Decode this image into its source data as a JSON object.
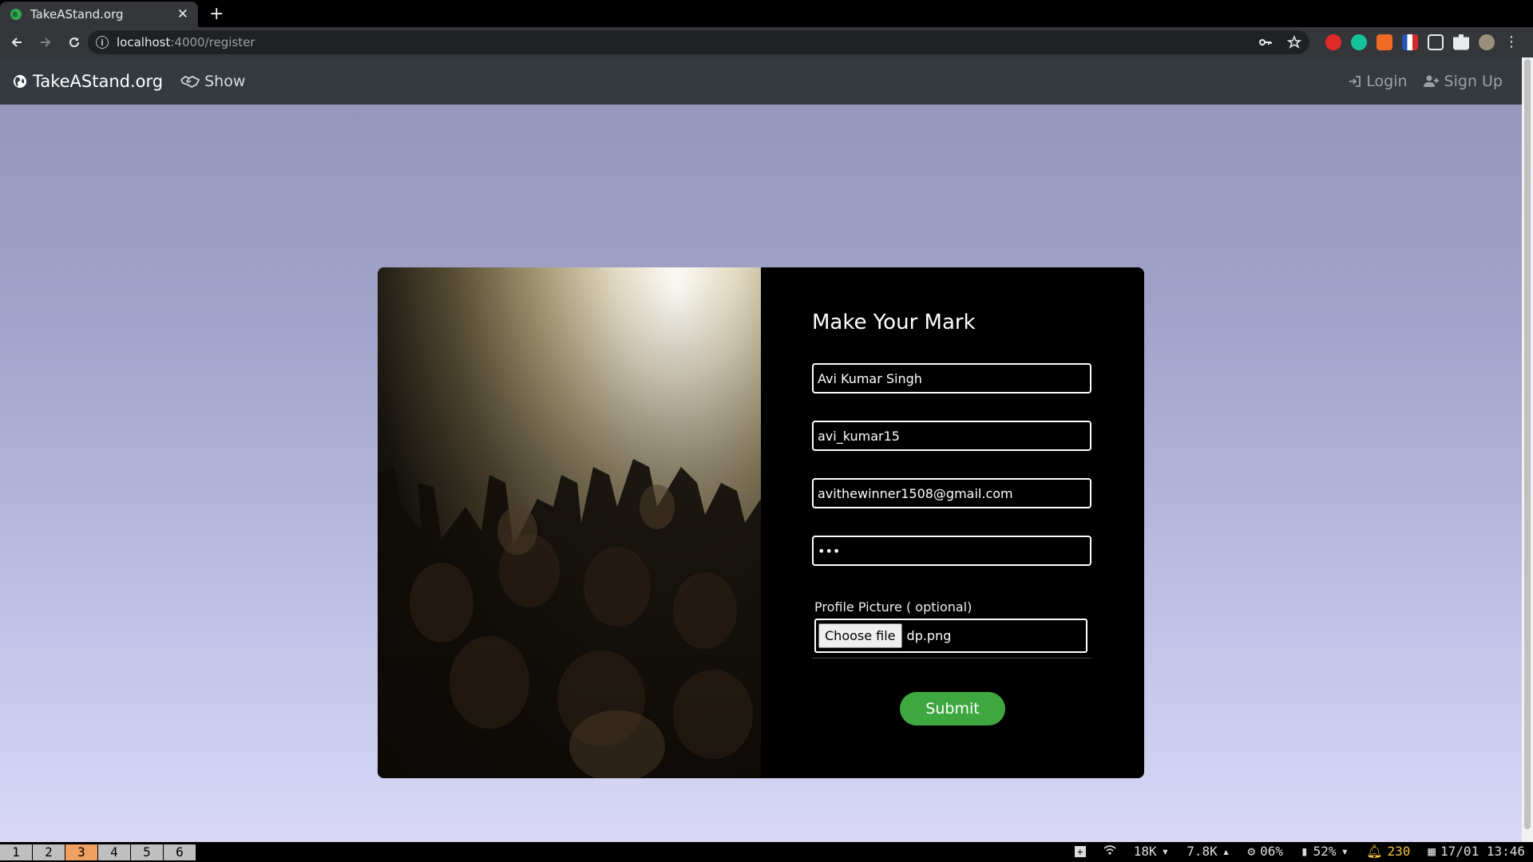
{
  "browser": {
    "tab_title": "TakeAStand.org",
    "url_host": "localhost",
    "url_path": ":4000/register"
  },
  "site": {
    "brand": "TakeAStand.org",
    "show_label": "Show",
    "login_label": "Login",
    "signup_label": "Sign Up"
  },
  "form": {
    "title": "Make Your Mark",
    "name_value": "Avi Kumar Singh",
    "username_value": "avi_kumar15",
    "email_value": "avithewinner1508@gmail.com",
    "password_value": "•••",
    "picture_label": "Profile Picture ( optional)",
    "file_button": "Choose file",
    "file_name": "dp.png",
    "submit_label": "Submit"
  },
  "statusbar": {
    "workspaces": [
      "1",
      "2",
      "3",
      "4",
      "5",
      "6"
    ],
    "active_workspace": "3",
    "net_down": "18K",
    "net_up": "7.8K",
    "cpu": "06%",
    "battery": "52%",
    "notifications": "230",
    "datetime": "17/01 13:46"
  },
  "colors": {
    "navbar_bg": "#333a40",
    "submit_green": "#3fa73f",
    "active_workspace": "#f0a060"
  }
}
